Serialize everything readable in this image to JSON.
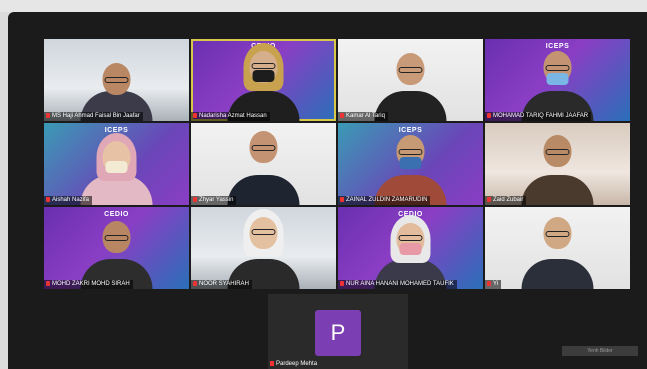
{
  "participants": [
    {
      "name": "MS Haji Ahmad Faisal Bin Jaafar",
      "bg": "room"
    },
    {
      "name": "Nadarisha Azmat Hassan",
      "bg": "purple",
      "logo": "CEDIO"
    },
    {
      "name": "Kamar Al Tariq",
      "bg": "white"
    },
    {
      "name": "MOHAMAD TARIQ FAHMI JAAFAR",
      "bg": "purple",
      "logo": "ICEPS"
    },
    {
      "name": "Aishah Nazifa",
      "bg": "teal",
      "logo": "ICEPS"
    },
    {
      "name": "Zhyar Yassin",
      "bg": "white"
    },
    {
      "name": "ZAINAL ZULDIN ZAMARUDIN",
      "bg": "teal",
      "logo": "ICEPS"
    },
    {
      "name": "Zaid Zubair",
      "bg": "warm"
    },
    {
      "name": "MOHD ZAKRI MOHD SIRAH",
      "bg": "purple",
      "logo": "CEDIO"
    },
    {
      "name": "NOOR SYAHIRAH",
      "bg": "room"
    },
    {
      "name": "NUR AINA HANANI MOHAMED TAUFIK",
      "bg": "purple",
      "logo": "CEDIO"
    },
    {
      "name": "Yi",
      "bg": "white"
    }
  ],
  "bottom_participant": {
    "initial": "P",
    "name": "Pardeep Mehta"
  },
  "self_view_label": "Yenh Bilder"
}
